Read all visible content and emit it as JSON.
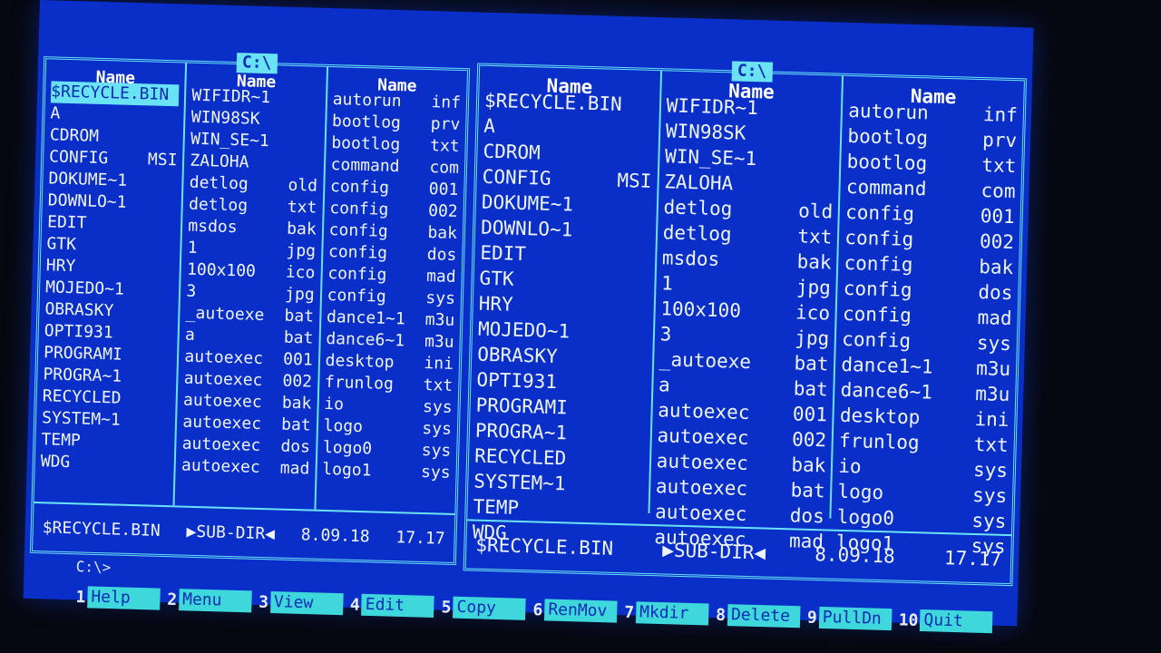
{
  "left_panel": {
    "drive": "C:\\",
    "column_header": "Name",
    "columns": [
      [
        [
          "$RECYCLE.BIN",
          ""
        ],
        [
          "A",
          ""
        ],
        [
          "CDROM",
          ""
        ],
        [
          "CONFIG",
          "MSI"
        ],
        [
          "DOKUME~1",
          ""
        ],
        [
          "DOWNLO~1",
          ""
        ],
        [
          "EDIT",
          ""
        ],
        [
          "GTK",
          ""
        ],
        [
          "HRY",
          ""
        ],
        [
          "MOJEDO~1",
          ""
        ],
        [
          "OBRASKY",
          ""
        ],
        [
          "OPTI931",
          ""
        ],
        [
          "PROGRAMI",
          ""
        ],
        [
          "PROGRA~1",
          ""
        ],
        [
          "RECYCLED",
          ""
        ],
        [
          "SYSTEM~1",
          ""
        ],
        [
          "TEMP",
          ""
        ],
        [
          "WDG",
          ""
        ]
      ],
      [
        [
          "WIFIDR~1",
          ""
        ],
        [
          "WIN98SK",
          ""
        ],
        [
          "WIN_SE~1",
          ""
        ],
        [
          "ZALOHA",
          ""
        ],
        [
          "detlog",
          "old"
        ],
        [
          "detlog",
          "txt"
        ],
        [
          "msdos",
          "bak"
        ],
        [
          "1",
          "jpg"
        ],
        [
          "100x100",
          "ico"
        ],
        [
          "3",
          "jpg"
        ],
        [
          "_autoexe",
          "bat"
        ],
        [
          "a",
          "bat"
        ],
        [
          "autoexec",
          "001"
        ],
        [
          "autoexec",
          "002"
        ],
        [
          "autoexec",
          "bak"
        ],
        [
          "autoexec",
          "bat"
        ],
        [
          "autoexec",
          "dos"
        ],
        [
          "autoexec",
          "mad"
        ]
      ],
      [
        [
          "autorun",
          "inf"
        ],
        [
          "bootlog",
          "prv"
        ],
        [
          "bootlog",
          "txt"
        ],
        [
          "command",
          "com"
        ],
        [
          "config",
          "001"
        ],
        [
          "config",
          "002"
        ],
        [
          "config",
          "bak"
        ],
        [
          "config",
          "dos"
        ],
        [
          "config",
          "mad"
        ],
        [
          "config",
          "sys"
        ],
        [
          "dance1~1",
          "m3u"
        ],
        [
          "dance6~1",
          "m3u"
        ],
        [
          "desktop",
          "ini"
        ],
        [
          "frunlog",
          "txt"
        ],
        [
          "io",
          "sys"
        ],
        [
          "logo",
          "sys"
        ],
        [
          "logo0",
          "sys"
        ],
        [
          "logo1",
          "sys"
        ]
      ]
    ],
    "status": {
      "name": "$RECYCLE.BIN",
      "type": "▶SUB-DIR◀",
      "date": "8.09.18",
      "time": "17.17"
    }
  },
  "right_panel": {
    "drive": "C:\\",
    "column_header": "Name",
    "columns": [
      [
        [
          "$RECYCLE.BIN",
          ""
        ],
        [
          "A",
          ""
        ],
        [
          "CDROM",
          ""
        ],
        [
          "CONFIG",
          "MSI"
        ],
        [
          "DOKUME~1",
          ""
        ],
        [
          "DOWNLO~1",
          ""
        ],
        [
          "EDIT",
          ""
        ],
        [
          "GTK",
          ""
        ],
        [
          "HRY",
          ""
        ],
        [
          "MOJEDO~1",
          ""
        ],
        [
          "OBRASKY",
          ""
        ],
        [
          "OPTI931",
          ""
        ],
        [
          "PROGRAMI",
          ""
        ],
        [
          "PROGRA~1",
          ""
        ],
        [
          "RECYCLED",
          ""
        ],
        [
          "SYSTEM~1",
          ""
        ],
        [
          "TEMP",
          ""
        ],
        [
          "WDG",
          ""
        ]
      ],
      [
        [
          "WIFIDR~1",
          ""
        ],
        [
          "WIN98SK",
          ""
        ],
        [
          "WIN_SE~1",
          ""
        ],
        [
          "ZALOHA",
          ""
        ],
        [
          "detlog",
          "old"
        ],
        [
          "detlog",
          "txt"
        ],
        [
          "msdos",
          "bak"
        ],
        [
          "1",
          "jpg"
        ],
        [
          "100x100",
          "ico"
        ],
        [
          "3",
          "jpg"
        ],
        [
          "_autoexe",
          "bat"
        ],
        [
          "a",
          "bat"
        ],
        [
          "autoexec",
          "001"
        ],
        [
          "autoexec",
          "002"
        ],
        [
          "autoexec",
          "bak"
        ],
        [
          "autoexec",
          "bat"
        ],
        [
          "autoexec",
          "dos"
        ],
        [
          "autoexec",
          "mad"
        ]
      ],
      [
        [
          "autorun",
          "inf"
        ],
        [
          "bootlog",
          "prv"
        ],
        [
          "bootlog",
          "txt"
        ],
        [
          "command",
          "com"
        ],
        [
          "config",
          "001"
        ],
        [
          "config",
          "002"
        ],
        [
          "config",
          "bak"
        ],
        [
          "config",
          "dos"
        ],
        [
          "config",
          "mad"
        ],
        [
          "config",
          "sys"
        ],
        [
          "dance1~1",
          "m3u"
        ],
        [
          "dance6~1",
          "m3u"
        ],
        [
          "desktop",
          "ini"
        ],
        [
          "frunlog",
          "txt"
        ],
        [
          "io",
          "sys"
        ],
        [
          "logo",
          "sys"
        ],
        [
          "logo0",
          "sys"
        ],
        [
          "logo1",
          "sys"
        ]
      ]
    ],
    "status": {
      "name": "$RECYCLE.BIN",
      "type": "▶SUB-DIR◀",
      "date": "8.09.18",
      "time": "17.17"
    }
  },
  "prompt": "C:\\>",
  "function_keys": [
    {
      "num": "1",
      "label": "Help"
    },
    {
      "num": "2",
      "label": "Menu"
    },
    {
      "num": "3",
      "label": "View"
    },
    {
      "num": "4",
      "label": "Edit"
    },
    {
      "num": "5",
      "label": "Copy"
    },
    {
      "num": "6",
      "label": "RenMov"
    },
    {
      "num": "7",
      "label": "Mkdir"
    },
    {
      "num": "8",
      "label": "Delete"
    },
    {
      "num": "9",
      "label": "PullDn"
    },
    {
      "num": "10",
      "label": "Quit"
    }
  ],
  "colors": {
    "background": "#0a2fc8",
    "border": "#69e3f4",
    "fkey": "#3ed8dc"
  }
}
